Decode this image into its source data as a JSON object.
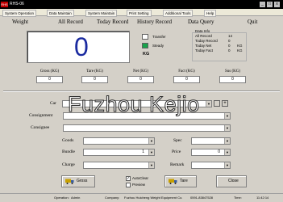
{
  "window": {
    "title": "RHS-06",
    "logo_text": "RHS",
    "min": "_",
    "max": "□",
    "close": "x"
  },
  "menu": [
    "System Operation",
    "Data Maintain",
    "System Maintain",
    "Print Setting",
    "Additional Tools",
    "Help"
  ],
  "toolbar": [
    "Weight",
    "All Record",
    "Today Record",
    "History Record",
    "Data Query",
    "Quit"
  ],
  "display": {
    "weight": "0"
  },
  "status": {
    "transfer": "Transfer",
    "steady": "Steady",
    "unit": "KG"
  },
  "data_info": {
    "title": "Data Info",
    "rows": [
      {
        "label": "All Record",
        "value": "14",
        "unit": ""
      },
      {
        "label": "Today Record",
        "value": "0",
        "unit": ""
      },
      {
        "label": "Today Net",
        "value": "0",
        "unit": "KG"
      },
      {
        "label": "Today Fact",
        "value": "0",
        "unit": "KG"
      }
    ]
  },
  "weights": [
    {
      "label": "Gross (KG)",
      "value": "0"
    },
    {
      "label": "Tare (KG)",
      "value": "0"
    },
    {
      "label": "Net (KG)",
      "value": "0"
    },
    {
      "label": "Fact (KG)",
      "value": "0"
    },
    {
      "label": "Sus (KG)",
      "value": "0"
    }
  ],
  "form": {
    "car_label": "Car",
    "consignment_label": "Consignment",
    "consignee_label": "Consignee",
    "goods_label": "Goods",
    "spec_label": "Spec",
    "bundle_label": "Bundle",
    "bundle_value": "1",
    "price_label": "Price",
    "price_value": "0",
    "charge_label": "Charge",
    "remark_label": "Remark",
    "plus": "+",
    "arrow": "▼"
  },
  "buttons": {
    "gross": "Gross",
    "tare": "Tare",
    "close": "Close"
  },
  "options": {
    "autoclear": "AutoClear",
    "autoclear_checked": "✓",
    "preview": "Preview"
  },
  "statusbar": {
    "operation_label": "Operation:",
    "operation_value": "Admin",
    "company_label": "Company:",
    "company_value": "Fuzhou Huicheng Weight Equipment Co.",
    "phone": "0591-83847528",
    "time_label": "Time:",
    "time_value": "11:42:14"
  },
  "watermark": "Fuzhou Kejio"
}
